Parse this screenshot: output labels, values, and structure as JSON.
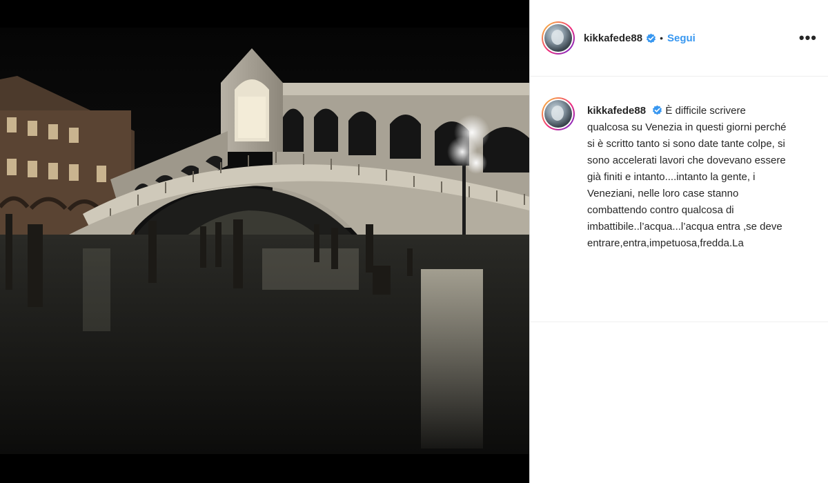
{
  "post": {
    "username": "kikkafede88",
    "follow_label": "Segui",
    "separator": "•",
    "more_label": "•••",
    "caption": "È difficile scrivere qualcosa su Venezia in questi giorni perché si è scritto tanto si sono date tante colpe, si sono accelerati lavori che dovevano essere già finiti e intanto....intanto la gente, i Veneziani, nelle loro case stanno combattendo contro qualcosa di imbattibile..l’acqua...l’acqua entra ,se deve entrare,entra,impetuosa,fredda.La"
  },
  "colors": {
    "follow": "#3897f0",
    "verified": "#3897f0",
    "text": "#262626"
  },
  "icons": {
    "verified": "verified-badge-icon",
    "more": "more-options-icon"
  }
}
